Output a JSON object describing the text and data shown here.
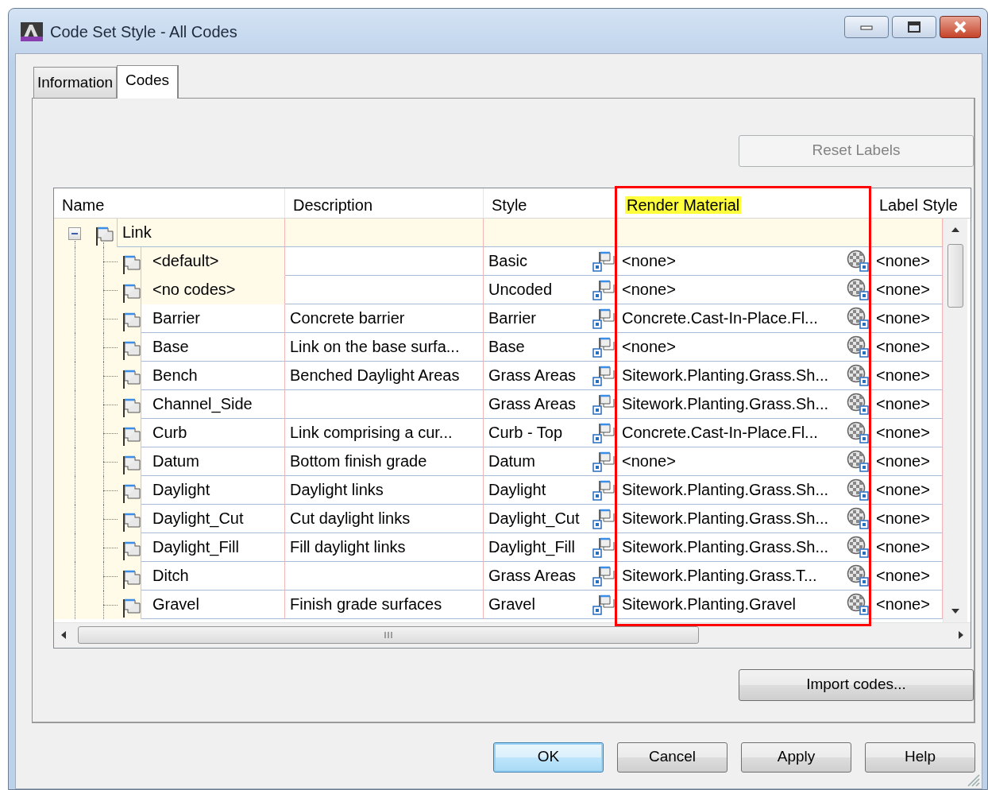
{
  "window": {
    "title": "Code Set Style - All Codes"
  },
  "tabs": [
    {
      "label": "Information",
      "selected": false
    },
    {
      "label": "Codes",
      "selected": true
    }
  ],
  "reset_button": {
    "label": "Reset Labels",
    "disabled": true
  },
  "table": {
    "columns": [
      {
        "label": "Name",
        "highlighted": false,
        "outlined": false
      },
      {
        "label": "Description",
        "highlighted": false,
        "outlined": false
      },
      {
        "label": "Style",
        "highlighted": false,
        "outlined": false
      },
      {
        "label": "Render Material",
        "highlighted": true,
        "outlined": true
      },
      {
        "label": "Label Style",
        "highlighted": false,
        "outlined": false
      }
    ],
    "tree": {
      "name": "Link",
      "expanded": true,
      "children": [
        {
          "name": "<default>",
          "style": "Basic",
          "render_material": "<none>",
          "label_style": "<none>",
          "locked": true
        },
        {
          "name": "<no codes>",
          "style": "Uncoded",
          "render_material": "<none>",
          "label_style": "<none>",
          "locked": true
        },
        {
          "name": "Barrier",
          "description": "Concrete barrier",
          "style": "Barrier",
          "render_material": "Concrete.Cast-In-Place.Fl...",
          "label_style": "<none>",
          "locked": false
        },
        {
          "name": "Base",
          "description": "Link on the base surfa...",
          "style": "Base",
          "render_material": "<none>",
          "label_style": "<none>",
          "locked": false
        },
        {
          "name": "Bench",
          "description": "Benched Daylight Areas",
          "style": "Grass Areas",
          "render_material": "Sitework.Planting.Grass.Sh...",
          "label_style": "<none>",
          "locked": false
        },
        {
          "name": "Channel_Side",
          "style": "Grass Areas",
          "render_material": "Sitework.Planting.Grass.Sh...",
          "label_style": "<none>",
          "locked": false
        },
        {
          "name": "Curb",
          "description": "Link comprising a cur...",
          "style": "Curb - Top",
          "render_material": "Concrete.Cast-In-Place.Fl...",
          "label_style": "<none>",
          "locked": false
        },
        {
          "name": "Datum",
          "description": "Bottom finish grade",
          "style": "Datum",
          "render_material": "<none>",
          "label_style": "<none>",
          "locked": false
        },
        {
          "name": "Daylight",
          "description": "Daylight links",
          "style": "Daylight",
          "render_material": "Sitework.Planting.Grass.Sh...",
          "label_style": "<none>",
          "locked": false
        },
        {
          "name": "Daylight_Cut",
          "description": "Cut daylight links",
          "style": "Daylight_Cut",
          "render_material": "Sitework.Planting.Grass.Sh...",
          "label_style": "<none>",
          "locked": false
        },
        {
          "name": "Daylight_Fill",
          "description": "Fill daylight links",
          "style": "Daylight_Fill",
          "render_material": "Sitework.Planting.Grass.Sh...",
          "label_style": "<none>",
          "locked": false
        },
        {
          "name": "Ditch",
          "style": "Grass Areas",
          "render_material": "Sitework.Planting.Grass.T...",
          "label_style": "<none>",
          "locked": false
        },
        {
          "name": "Gravel",
          "description": "Finish grade surfaces",
          "style": "Gravel",
          "render_material": "Sitework.Planting.Gravel",
          "label_style": "<none>",
          "locked": false
        }
      ]
    }
  },
  "import_button": {
    "label": "Import codes..."
  },
  "buttons": [
    {
      "label": "OK",
      "default": true
    },
    {
      "label": "Cancel",
      "default": false
    },
    {
      "label": "Apply",
      "default": false
    },
    {
      "label": "Help",
      "default": false
    }
  ]
}
